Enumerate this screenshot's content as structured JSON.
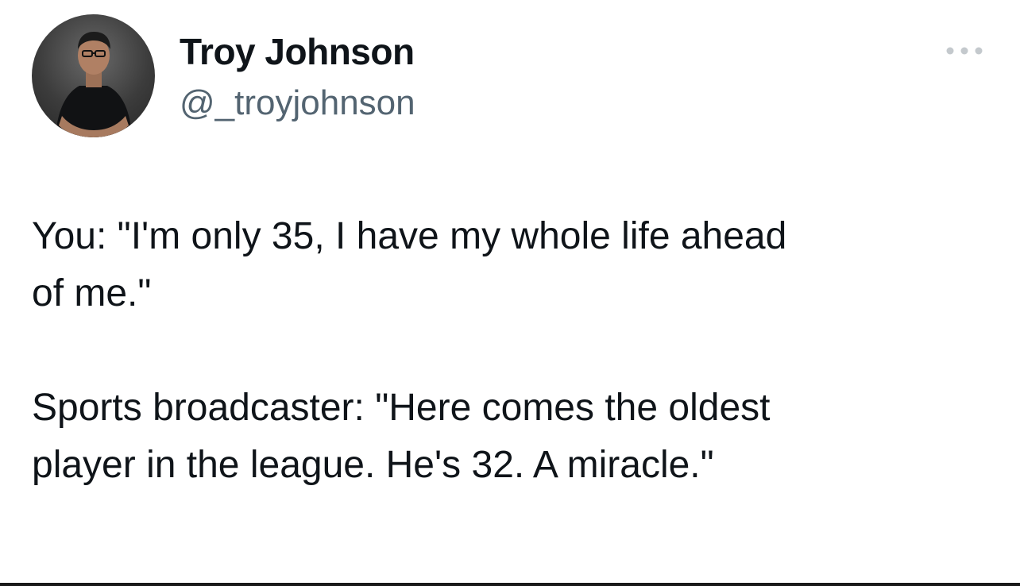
{
  "author": {
    "name": "Troy Johnson",
    "handle": "@_troyjohnson",
    "avatar_icon": "avatar-photo"
  },
  "header": {
    "more_icon": "more-dots-icon"
  },
  "tweet": {
    "paragraphs": [
      {
        "lines": [
          "You: \"I'm only 35, I have my whole life ahead",
          "of me.\""
        ]
      },
      {
        "lines": [
          "Sports broadcaster: \"Here comes the oldest",
          "player in the league. He's 32. A miracle.\""
        ]
      }
    ]
  },
  "colors": {
    "text": "#0f1419",
    "secondary_text": "#536471",
    "background": "#ffffff",
    "more_dots": "#c4c9cd"
  }
}
